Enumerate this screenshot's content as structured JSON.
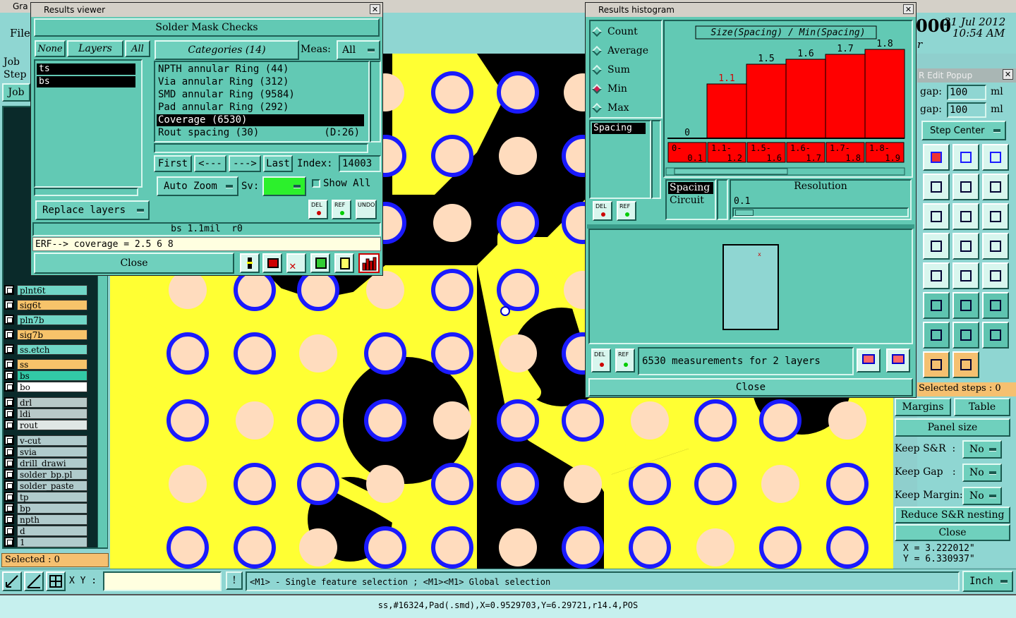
{
  "main_window": {
    "title_fragment": "Gra",
    "menu_file": "File",
    "date": "21 Jul 2012",
    "time": "10:54 AM",
    "clock_fragment": "000",
    "r_fragment": "r"
  },
  "left_panel": {
    "job_label": "Job",
    "step_label": "Step",
    "job_button": "Job",
    "layers": [
      {
        "name": "plnt6t",
        "color": "#70d6c6"
      },
      {
        "name": "sig6t",
        "color": "#f7c36a"
      },
      {
        "name": "pln7b",
        "color": "#70d6c6"
      },
      {
        "name": "sig7b",
        "color": "#f7c36a"
      },
      {
        "name": "ss.etch",
        "color": "#70d6c6"
      },
      {
        "name": "ss",
        "color": "#f7c36a"
      },
      {
        "name": "bs",
        "color": "#32c9a6"
      },
      {
        "name": "bo",
        "color": "#ffffff"
      },
      {
        "name": "drl",
        "color": "#b8c9c8"
      },
      {
        "name": "ldi",
        "color": "#b8c9c8"
      },
      {
        "name": "rout",
        "color": "#dfe6e5"
      },
      {
        "name": "v-cut",
        "color": "#b0cbcc"
      },
      {
        "name": "svia",
        "color": "#b0cbcc"
      },
      {
        "name": "drill_drawi",
        "color": "#b0cbcc"
      },
      {
        "name": "solder_bp.pl",
        "color": "#b0cbcc"
      },
      {
        "name": "solder_paste",
        "color": "#b0cbcc"
      },
      {
        "name": "tp",
        "color": "#b0cbcc"
      },
      {
        "name": "bp",
        "color": "#b0cbcc"
      },
      {
        "name": "npth",
        "color": "#b0cbcc"
      },
      {
        "name": "d",
        "color": "#b0cbcc"
      },
      {
        "name": "1",
        "color": "#b0cbcc"
      }
    ],
    "selected_status": "Selected : 0"
  },
  "results_viewer": {
    "title": "Results viewer",
    "header": "Solder Mask Checks",
    "none_btn": "None",
    "layers_btn": "Layers",
    "all_btn": "All",
    "layer_list": [
      "ts",
      "bs"
    ],
    "categories_btn": "Categories (14)",
    "meas_label": "Meas:",
    "meas_value": "All",
    "categories": [
      {
        "text": "NPTH annular Ring (44)",
        "suffix": "",
        "selected": false
      },
      {
        "text": "Via annular Ring (312)",
        "suffix": "",
        "selected": false
      },
      {
        "text": "SMD annular Ring (9584)",
        "suffix": "",
        "selected": false
      },
      {
        "text": "Pad annular Ring (292)",
        "suffix": "",
        "selected": false
      },
      {
        "text": "Coverage (6530)",
        "suffix": "",
        "selected": true
      },
      {
        "text": "Rout spacing (30)",
        "suffix": "(D:26)",
        "selected": false
      }
    ],
    "first_btn": "First",
    "prev_btn": "<---",
    "next_btn": "--->",
    "last_btn": "Last",
    "index_label": "Index:",
    "index_value": "14003",
    "replace_layers": "Replace layers",
    "auto_zoom": "Auto Zoom",
    "sv_label": "Sv:",
    "show_all": "Show All",
    "del": "DEL",
    "ref": "REF",
    "undo": "UNDO",
    "status": "bs 1.1mil  r0",
    "erf": "ERF--> coverage = 2.5 6 8",
    "close": "Close"
  },
  "histogram": {
    "title": "Results histogram",
    "modes": [
      {
        "label": "Count",
        "selected": false
      },
      {
        "label": "Average",
        "selected": false
      },
      {
        "label": "Sum",
        "selected": false
      },
      {
        "label": "Min",
        "selected": true
      },
      {
        "label": "Max",
        "selected": false
      }
    ],
    "chart_title": "Size(Spacing) / Min(Spacing)",
    "list_item": "Spacing",
    "del": "DEL",
    "ref": "REF",
    "type_items": [
      "Spacing",
      "Circuit"
    ],
    "resolution_label": "Resolution",
    "resolution_value": "0.1",
    "summary": "6530 measurements for 2 layers",
    "close": "Close"
  },
  "chart_data": {
    "type": "bar",
    "title": "Size(Spacing) / Min(Spacing)",
    "categories": [
      "0-0.1",
      "1.1-1.2",
      "1.5-1.6",
      "1.6-1.7",
      "1.7-1.8",
      "1.8-1.9"
    ],
    "values": [
      0,
      1.1,
      1.5,
      1.6,
      1.7,
      1.8
    ],
    "value_labels": [
      "0",
      "1.1",
      "1.5",
      "1.6",
      "1.7",
      "1.8"
    ],
    "ylim": [
      0,
      2.0
    ],
    "bar_color": "#ff0000",
    "highlight_label_color": "#d40000"
  },
  "sr_popup": {
    "title": "R Edit Popup",
    "x_gap_label": "gap:",
    "x_gap_value": "100",
    "x_unit": "ml",
    "y_gap_label": "gap:",
    "y_gap_value": "100",
    "y_unit": "ml",
    "step_center": "Step Center",
    "selected_steps": "Selected steps : 0",
    "margins": "Margins",
    "table": "Table",
    "panel_size": "Panel size",
    "keep_sr_label": "Keep S&R  :",
    "keep_sr_value": "No",
    "keep_gap_label": "Keep Gap   :",
    "keep_gap_value": "No",
    "keep_margin_label": "Keep Margin:",
    "keep_margin_value": "No",
    "reduce": "Reduce S&R nesting",
    "close": "Close",
    "coord_x": "X = 3.222012\"",
    "coord_y": "Y = 6.330937\""
  },
  "bottom_bar": {
    "xy_label": "X Y :",
    "xy_value": "",
    "info_btn": "!",
    "hint": "<M1> - Single feature selection ; <M1><M1> Global selection",
    "unit": "Inch",
    "status": "ss,#16324,Pad(.smd),X=0.9529703,Y=6.29721,r14.4,POS"
  },
  "colors": {
    "teal": "#62c9b4",
    "canvas_black": "#000000",
    "trace_yellow": "#ffff33",
    "pad_peach": "#ffdcbe",
    "ring_blue": "#1a1aff"
  }
}
